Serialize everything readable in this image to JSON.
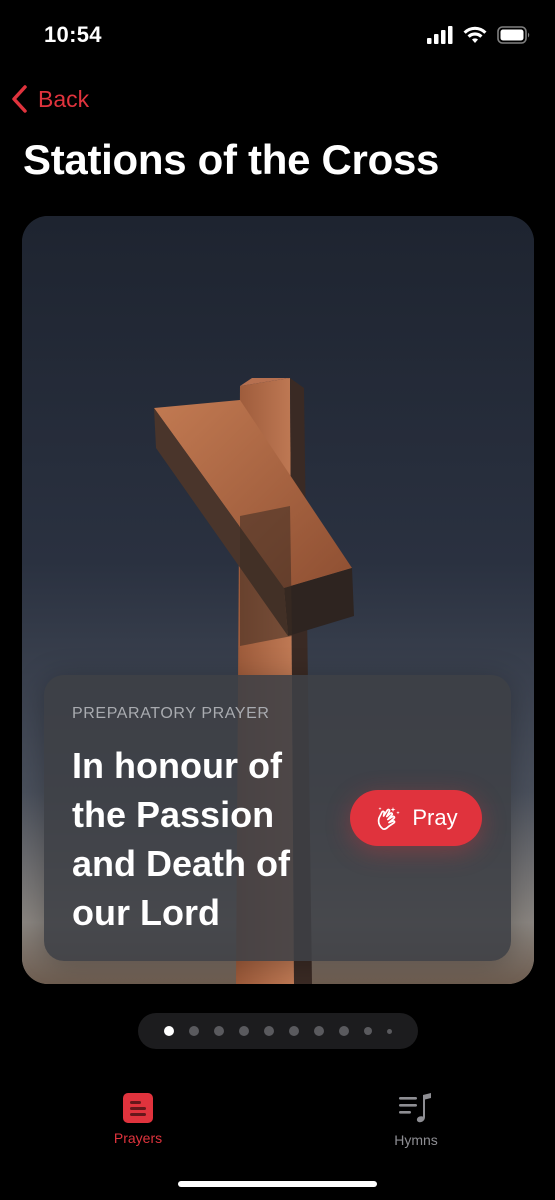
{
  "status_bar": {
    "time": "10:54"
  },
  "nav": {
    "back_label": "Back"
  },
  "page": {
    "title": "Stations of the Cross"
  },
  "card": {
    "eyebrow": "PREPARATORY PRAYER",
    "title": "In honour of the Passion and Death of our Lord",
    "pray_label": "Pray"
  },
  "pager": {
    "total": 10,
    "current": 1
  },
  "tabs": [
    {
      "label": "Prayers",
      "icon": "prayers-icon",
      "selected": true
    },
    {
      "label": "Hymns",
      "icon": "music-note-icon",
      "selected": false
    }
  ],
  "colors": {
    "accent": "#e0333d",
    "background": "#000000",
    "inactive": "#8e8e93"
  }
}
